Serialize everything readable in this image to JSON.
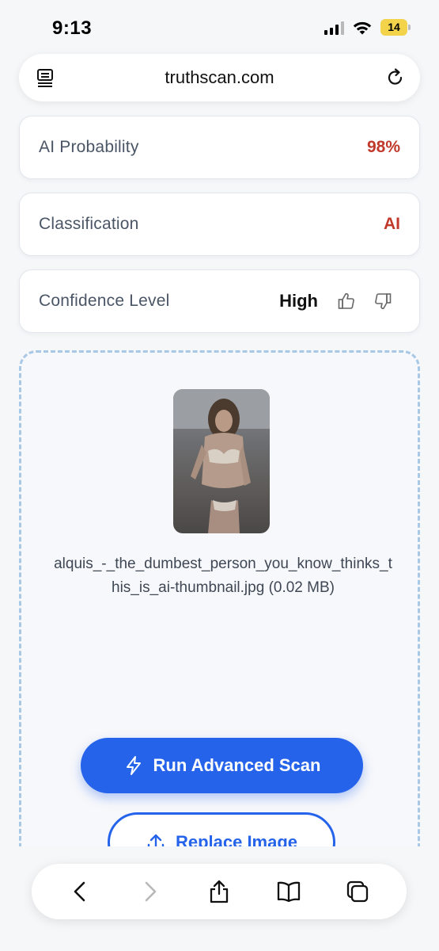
{
  "status_bar": {
    "time": "9:13",
    "battery": "14"
  },
  "browser": {
    "url": "truthscan.com"
  },
  "results": [
    {
      "label": "AI Probability",
      "value": "98%"
    },
    {
      "label": "Classification",
      "value": "AI"
    },
    {
      "label": "Confidence Level",
      "value": "High"
    }
  ],
  "upload": {
    "file_name": "alquis_-_the_dumbest_person_you_know_thinks_this_is_ai-thumbnail.jpg (0.02 MB)",
    "scan_button": "Run Advanced Scan",
    "replace_button": "Replace Image"
  },
  "colors": {
    "accent": "#2563eb",
    "danger": "#c0392b"
  },
  "icons": [
    "reader-mode-icon",
    "reload-icon",
    "thumbs-up-icon",
    "thumbs-down-icon",
    "lightning-icon",
    "upload-icon",
    "back-icon",
    "forward-icon",
    "share-icon",
    "bookmarks-icon",
    "tabs-icon"
  ]
}
